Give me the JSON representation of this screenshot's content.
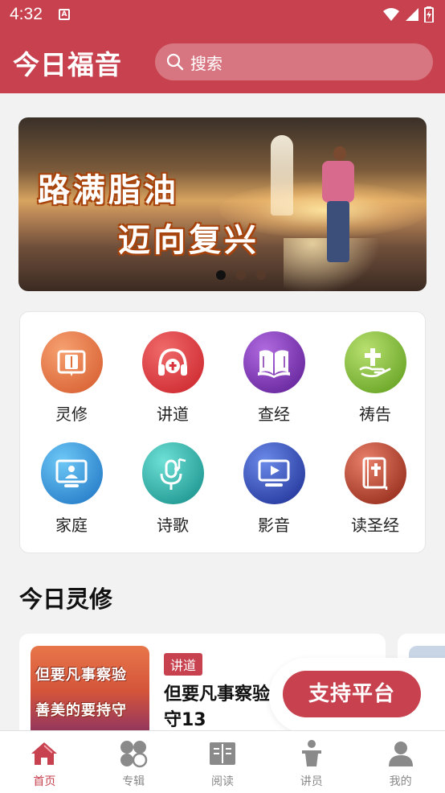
{
  "status_bar": {
    "time": "4:32"
  },
  "header": {
    "title": "今日福音",
    "search_placeholder": "搜索"
  },
  "banner": {
    "line1": "路满脂油",
    "line2": "迈向复兴",
    "slide_count": 3,
    "active_slide": 0
  },
  "menu": {
    "items": [
      {
        "label": "灵修",
        "icon": "book-icon",
        "color": "#e0703a"
      },
      {
        "label": "讲道",
        "icon": "headphones-cross-icon",
        "color": "#d8323c"
      },
      {
        "label": "查经",
        "icon": "open-bible-icon",
        "color": "#7a2aa8"
      },
      {
        "label": "祷告",
        "icon": "praying-hand-cross-icon",
        "color": "#6aa82a"
      },
      {
        "label": "家庭",
        "icon": "family-screen-icon",
        "color": "#2a8ad4"
      },
      {
        "label": "诗歌",
        "icon": "microphone-music-icon",
        "color": "#1ea8a0"
      },
      {
        "label": "影音",
        "icon": "video-player-icon",
        "color": "#2a4ab0"
      },
      {
        "label": "读圣经",
        "icon": "bible-cross-icon",
        "color": "#b83a2a"
      }
    ]
  },
  "section": {
    "title": "今日灵修"
  },
  "article": {
    "tag": "讲道",
    "title": "但要凡事察验，美善的要持守13",
    "thumb_line1": "但要凡事察验",
    "thumb_line2": "善美的要持守"
  },
  "support": {
    "label": "支持平台"
  },
  "bottom_nav": {
    "items": [
      {
        "label": "首页",
        "icon": "home-icon",
        "active": true
      },
      {
        "label": "专辑",
        "icon": "album-icon",
        "active": false
      },
      {
        "label": "阅读",
        "icon": "reading-icon",
        "active": false
      },
      {
        "label": "讲员",
        "icon": "speaker-icon",
        "active": false
      },
      {
        "label": "我的",
        "icon": "profile-icon",
        "active": false
      }
    ]
  },
  "colors": {
    "brand": "#c8414f",
    "active_nav": "#c8414f",
    "inactive_nav": "#888888"
  }
}
